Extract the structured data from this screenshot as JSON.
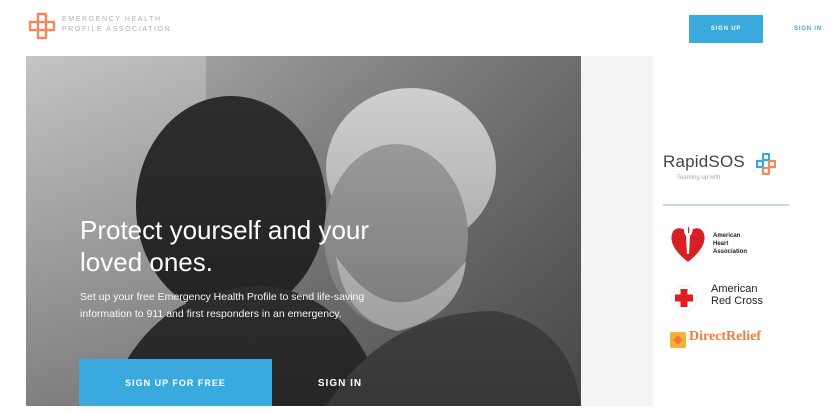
{
  "header": {
    "logo_text_line1": "EMERGENCY HEALTH",
    "logo_text_line2": "PROFILE ASSOCIATION",
    "signup_label": "SIGN UP",
    "signin_label": "SIGN IN"
  },
  "hero": {
    "title": "Protect yourself and your loved ones.",
    "subtitle": "Set up your free Emergency Health Profile to send life-saving information to 911 and first responders in an emergency.",
    "signup_label": "SIGN UP FOR FREE",
    "signin_label": "SIGN IN"
  },
  "partners": {
    "rapidsos": {
      "name": "RapidSOS",
      "tagline": "Teaming up with"
    },
    "aha": {
      "line1": "American",
      "line2": "Heart",
      "line3": "Association"
    },
    "redcross": {
      "line1": "American",
      "line2": "Red Cross"
    },
    "directrelief": {
      "name": "DirectRelief"
    }
  },
  "colors": {
    "brand_orange": "#f08a5d",
    "accent_blue": "#3aa9de",
    "aha_red": "#d71f26",
    "redcross_red": "#e21b22"
  },
  "icons": {
    "logo": "emergency-health-profile-logo",
    "rapidsos_mark": "rapidsos-logo",
    "aha_heart": "heart-torch-logo",
    "redcross_cross": "red-cross-logo",
    "direct_relief": "direct-relief-logo"
  }
}
